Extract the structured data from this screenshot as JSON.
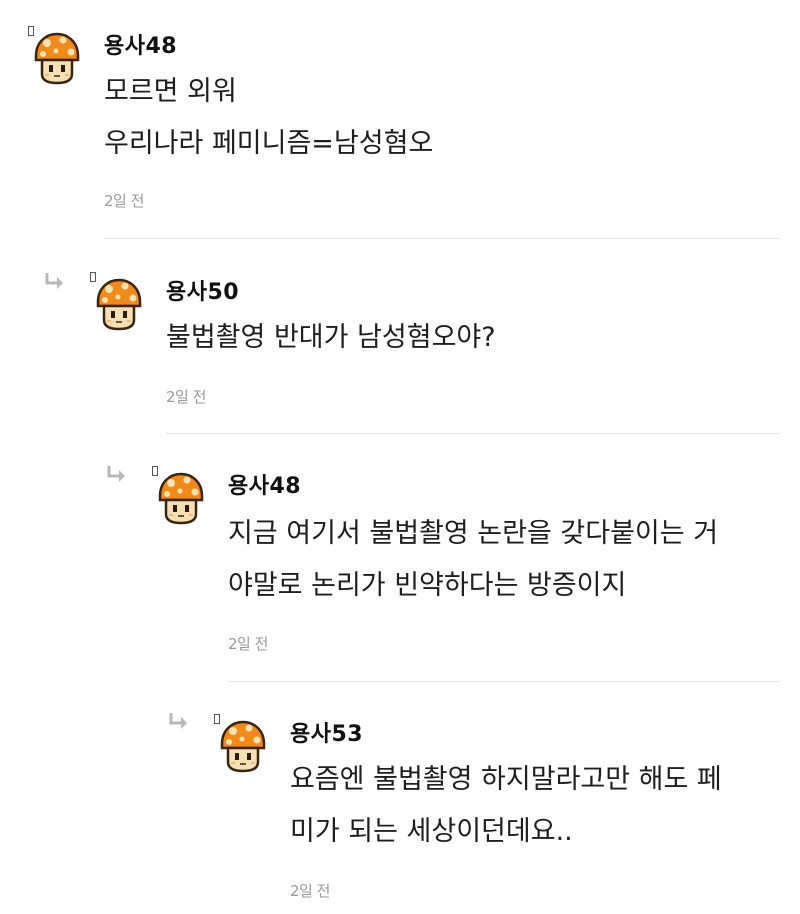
{
  "icons": {
    "avatar": "orange-mushroom-icon",
    "reply": "reply-arrow-icon",
    "level": "level-badge-icon"
  },
  "colors": {
    "mushroom_cap": "#f08a1a",
    "mushroom_spot": "#fbe2b0",
    "mushroom_face": "#f7dfb4",
    "outline": "#3a2410",
    "reply_arrow": "#b8b8b8",
    "divider": "#e3e3e3",
    "timestamp": "#9a9a9a"
  },
  "comments": [
    {
      "username": "용사48",
      "lines": [
        "모르면 외워",
        "우리나라 페미니즘=남성혐오"
      ],
      "timestamp": "2일 전",
      "is_reply": false
    },
    {
      "username": "용사50",
      "lines": [
        "불법촬영 반대가 남성혐오야?"
      ],
      "timestamp": "2일 전",
      "is_reply": true
    },
    {
      "username": "용사48",
      "lines": [
        "지금 여기서 불법촬영 논란을 갖다붙이는 거",
        "야말로 논리가 빈약하다는 방증이지"
      ],
      "timestamp": "2일 전",
      "is_reply": true
    },
    {
      "username": "용사53",
      "lines": [
        "요즘엔 불법촬영 하지말라고만 해도 페",
        "미가 되는 세상이던데요.."
      ],
      "timestamp": "2일 전",
      "is_reply": true
    }
  ]
}
